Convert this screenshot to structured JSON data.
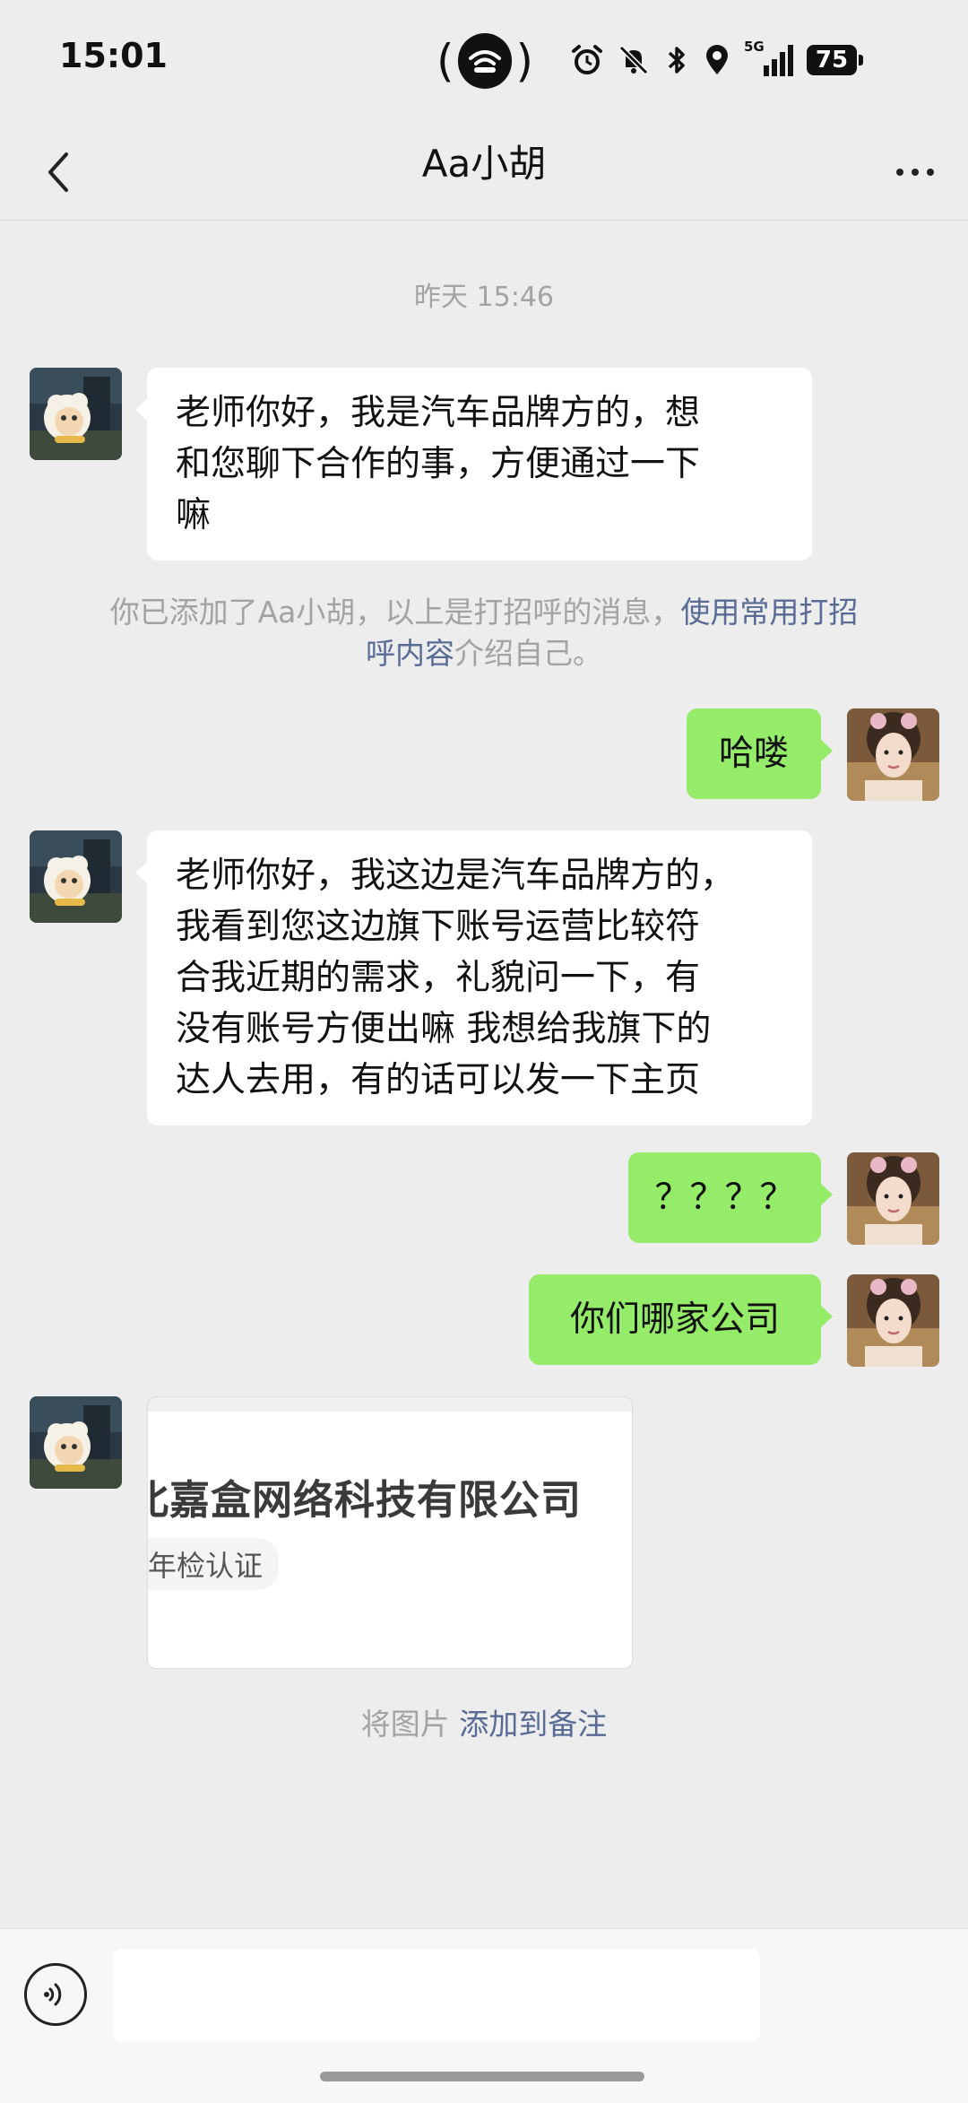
{
  "status_bar": {
    "time": "15:01",
    "battery": "75",
    "network": "5G"
  },
  "nav": {
    "title": "Aa小胡"
  },
  "chat": {
    "timestamp": "昨天 15:46",
    "msg1": "老师你好，我是汽车品牌方的，想\n和您聊下合作的事，方便通过一下\n嘛",
    "notice_prefix": "你已添加了Aa小胡，以上是打招呼的消息，",
    "notice_link": "使用常用打招\n呼内容",
    "notice_suffix": "介绍自己。",
    "msg2": "哈喽",
    "msg3": "老师你好，我这边是汽车品牌方的，\n我看到您这边旗下账号运营比较符\n合我近期的需求，礼貌问一下，有\n没有账号方便出嘛 我想给我旗下的\n达人去用，有的话可以发一下主页",
    "msg4": "？？？？",
    "msg5": "你们哪家公司",
    "image_company": "北嘉盒网络科技有限公司",
    "image_tag": "年检认证",
    "note_prefix": "将图片 ",
    "note_link": "添加到备注"
  },
  "input": {
    "placeholder": ""
  },
  "colors": {
    "background": "#ededed",
    "bubble_self": "#95ec69",
    "bubble_other": "#ffffff",
    "link": "#576b95"
  }
}
